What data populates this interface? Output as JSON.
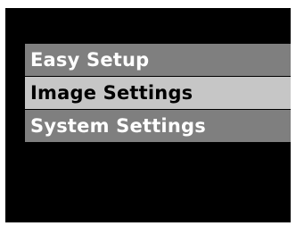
{
  "menu": {
    "items": [
      {
        "label": "Easy Setup",
        "selected": false
      },
      {
        "label": "Image Settings",
        "selected": true
      },
      {
        "label": "System Settings",
        "selected": false
      }
    ]
  },
  "colors": {
    "screen_background": "#000000",
    "item_background": "#7f7f7f",
    "item_text": "#ffffff",
    "selected_background": "#c6c6c6",
    "selected_text": "#000000"
  }
}
